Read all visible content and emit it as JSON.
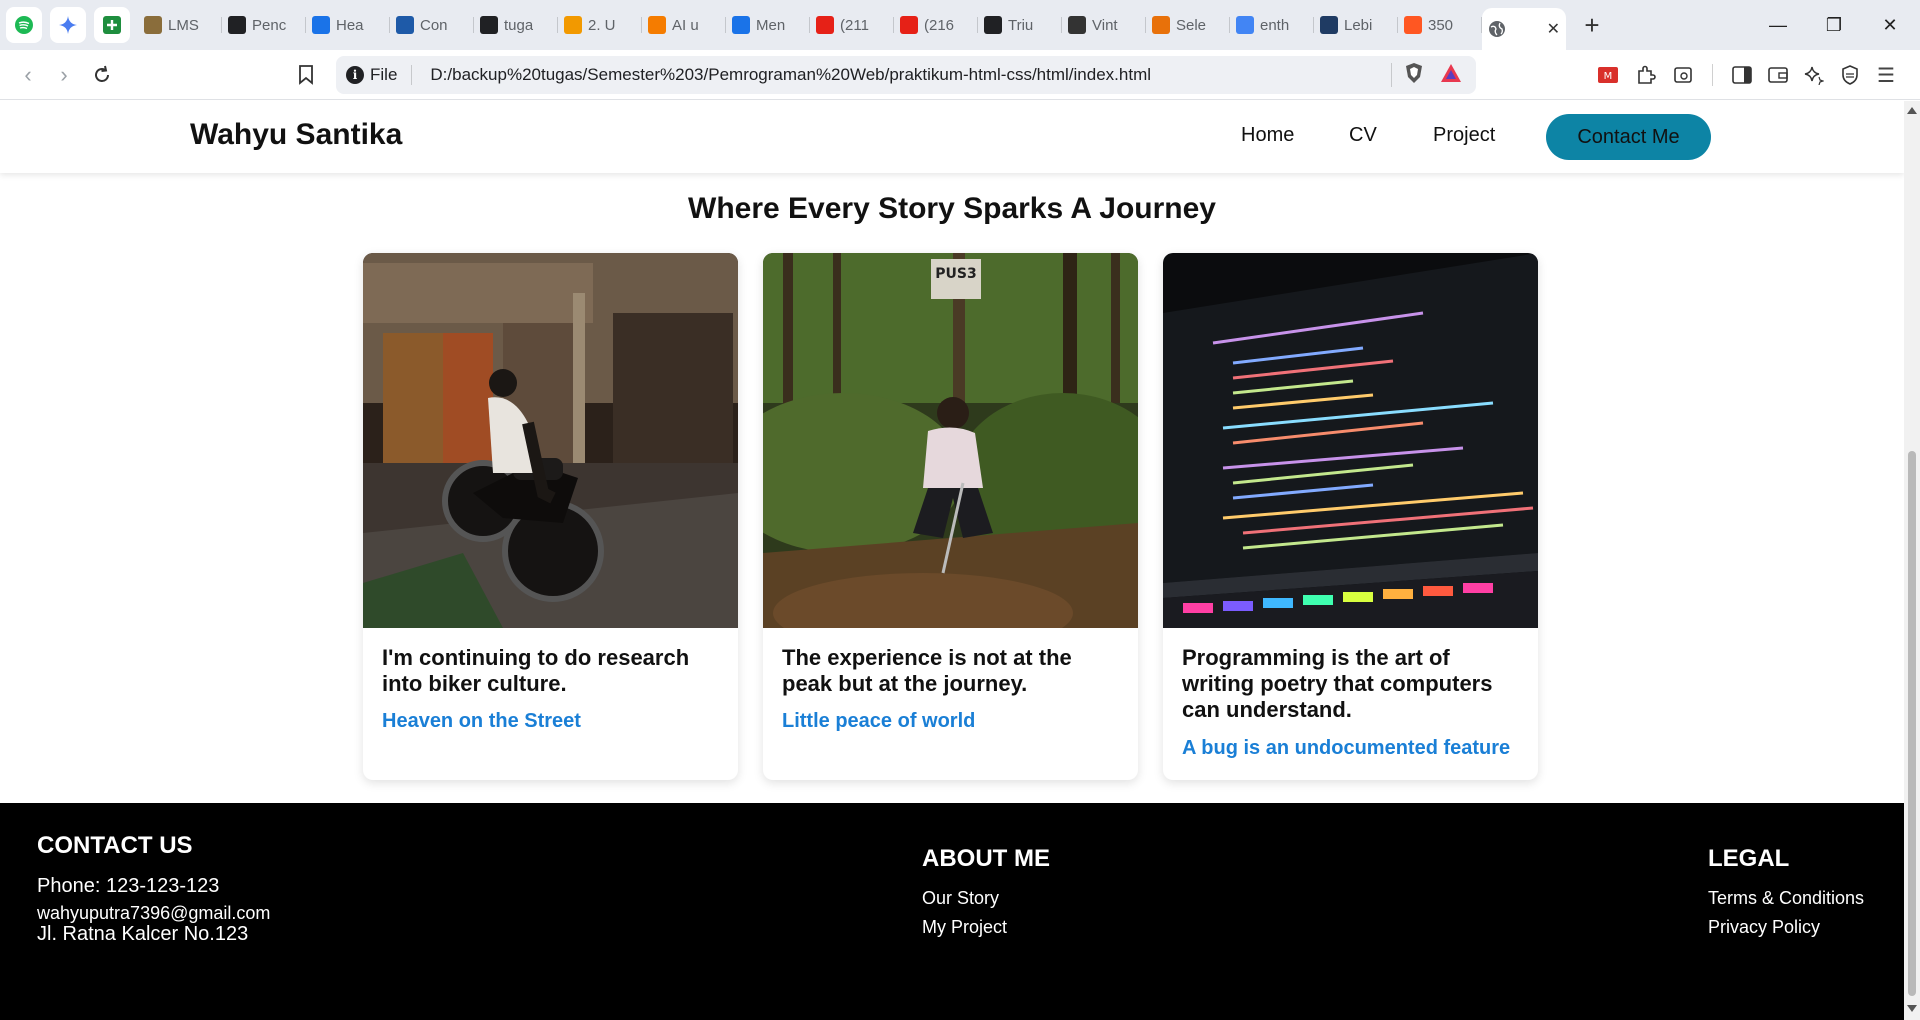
{
  "browser": {
    "tabs": [
      {
        "title": "LMS",
        "icon": "lms-icon",
        "color": "#8a6d3b"
      },
      {
        "title": "Penc",
        "icon": "openai-icon",
        "color": "#202124"
      },
      {
        "title": "Hea",
        "icon": "k-icon",
        "color": "#1a73e8"
      },
      {
        "title": "Con",
        "icon": "doc-icon",
        "color": "#1e5aa8"
      },
      {
        "title": "tuga",
        "icon": "github-icon",
        "color": "#202124"
      },
      {
        "title": "2. U",
        "icon": "chart-icon",
        "color": "#f29900"
      },
      {
        "title": "AI u",
        "icon": "infinity-icon",
        "color": "#f57c00"
      },
      {
        "title": "Men",
        "icon": "diamond-icon",
        "color": "#1a73e8"
      },
      {
        "title": "(211",
        "icon": "youtube-icon",
        "color": "#e62117"
      },
      {
        "title": "(216",
        "icon": "youtube-icon",
        "color": "#e62117"
      },
      {
        "title": "Triu",
        "icon": "triumph-icon",
        "color": "#202124"
      },
      {
        "title": "Vint",
        "icon": "vinted-icon",
        "color": "#333333"
      },
      {
        "title": "Sele",
        "icon": "grid-icon",
        "color": "#e8710a"
      },
      {
        "title": "enth",
        "icon": "google-icon",
        "color": "#4285f4"
      },
      {
        "title": "Lebi",
        "icon": "bird-icon",
        "color": "#1f3b63"
      },
      {
        "title": "350",
        "icon": "six-icon",
        "color": "#ff5722"
      }
    ],
    "omnibox": {
      "scheme_label": "File",
      "url": "D:/backup%20tugas/Semester%203/Pemrograman%20Web/praktikum-html-css/html/index.html"
    }
  },
  "site": {
    "brand": "Wahyu Santika",
    "nav": {
      "home": "Home",
      "cv": "CV",
      "project": "Project",
      "contact": "Contact Me"
    },
    "accent": "#0d84a5",
    "section_title": "Where Every Story Sparks A Journey",
    "cards": [
      {
        "title": "I'm continuing to do research into biker culture.",
        "subtitle": "Heaven on the Street",
        "image": "motorcycle-photo"
      },
      {
        "title": "The experience is not at the peak but at the journey.",
        "subtitle": "Little peace of world",
        "image": "forest-photo"
      },
      {
        "title": "Programming is the art of writing poetry that computers can understand.",
        "subtitle": "A bug is an undocumented feature",
        "image": "code-laptop-photo"
      }
    ],
    "footer": {
      "contact": {
        "heading": "CONTACT US",
        "phone": "Phone: 123-123-123",
        "email": "wahyuputra7396@gmail.com",
        "address": "Jl. Ratna Kalcer No.123"
      },
      "about": {
        "heading": "ABOUT ME",
        "links": [
          "Our Story",
          "My Project"
        ]
      },
      "legal": {
        "heading": "LEGAL",
        "links": [
          "Terms & Conditions",
          "Privacy Policy"
        ]
      }
    }
  }
}
